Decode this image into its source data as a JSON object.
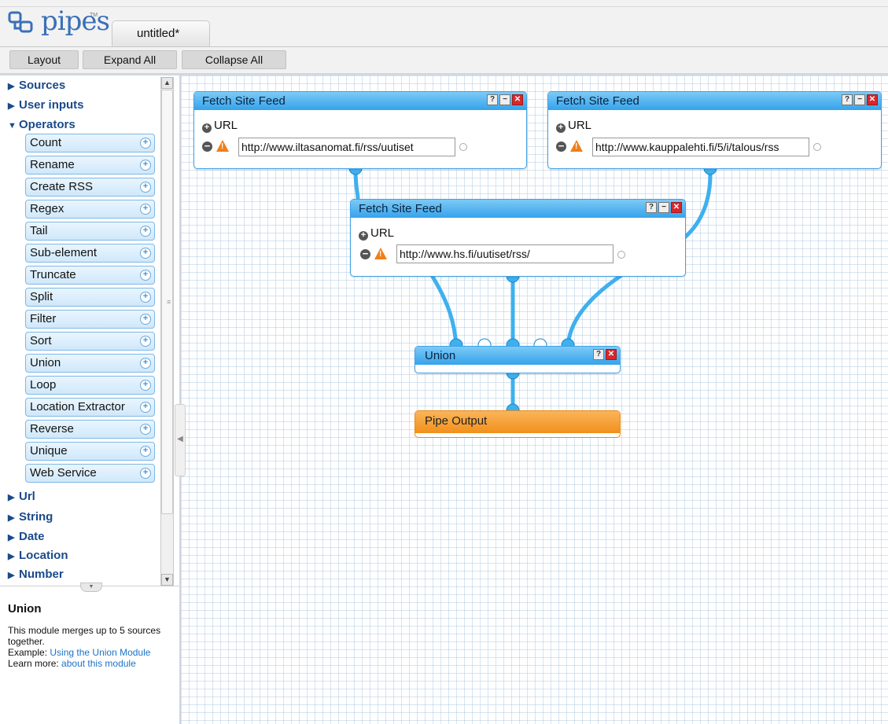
{
  "app": {
    "logo": "pipes",
    "tm": "TM"
  },
  "tabs": [
    {
      "label": "untitled*"
    }
  ],
  "toolbar": {
    "layout": "Layout",
    "expand_all": "Expand All",
    "collapse_all": "Collapse All"
  },
  "sidebar": {
    "categories_top": [
      "Sources",
      "User inputs",
      "Operators"
    ],
    "operators": [
      "Count",
      "Rename",
      "Create RSS",
      "Regex",
      "Tail",
      "Sub-element",
      "Truncate",
      "Split",
      "Filter",
      "Sort",
      "Union",
      "Loop",
      "Location Extractor",
      "Reverse",
      "Unique",
      "Web Service"
    ],
    "categories_bottom": [
      "Url",
      "String",
      "Date",
      "Location",
      "Number"
    ]
  },
  "help": {
    "title": "Union",
    "description": "This module merges up to 5 sources together.",
    "example_label": "Example:",
    "example_link": "Using the Union Module",
    "learn_label": "Learn more:",
    "learn_link": "about this module"
  },
  "modules": {
    "fetch1": {
      "title": "Fetch Site Feed",
      "field_label": "URL",
      "url": "http://www.iltasanomat.fi/rss/uutiset"
    },
    "fetch2": {
      "title": "Fetch Site Feed",
      "field_label": "URL",
      "url": "http://www.kauppalehti.fi/5/i/talous/rss"
    },
    "fetch3": {
      "title": "Fetch Site Feed",
      "field_label": "URL",
      "url": "http://www.hs.fi/uutiset/rss/"
    },
    "union": {
      "title": "Union"
    },
    "output": {
      "title": "Pipe Output"
    }
  },
  "controls": {
    "help": "?",
    "minimize": "−",
    "close": "✕"
  }
}
